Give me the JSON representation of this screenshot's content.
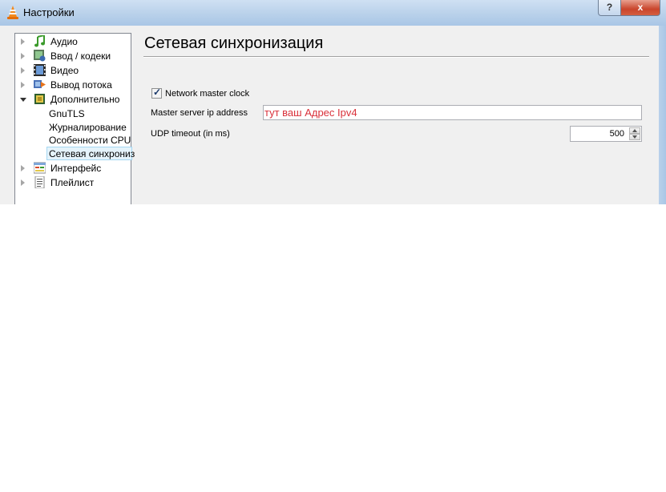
{
  "window": {
    "title": "Настройки",
    "help_label": "?",
    "close_label": "x"
  },
  "sidebar": {
    "items": [
      {
        "label": "Аудио",
        "icon": "music-note-icon",
        "expanded": false
      },
      {
        "label": "Ввод / кодеки",
        "icon": "input-codecs-icon",
        "expanded": false
      },
      {
        "label": "Видео",
        "icon": "film-icon",
        "expanded": false
      },
      {
        "label": "Вывод потока",
        "icon": "stream-output-icon",
        "expanded": false
      },
      {
        "label": "Дополнительно",
        "icon": "chip-icon",
        "expanded": true,
        "children": [
          {
            "label": "GnuTLS"
          },
          {
            "label": "Журналирование"
          },
          {
            "label": "Особенности CPU"
          },
          {
            "label": "Сетевая синхрониз",
            "selected": true
          }
        ]
      },
      {
        "label": "Интерфейс",
        "icon": "interface-icon",
        "expanded": false
      },
      {
        "label": "Плейлист",
        "icon": "playlist-icon",
        "expanded": false
      }
    ]
  },
  "panel": {
    "title": "Сетевая синхронизация",
    "network_master_clock": {
      "label": "Network master clock",
      "checked": true
    },
    "master_server_ip": {
      "label": "Master server ip address",
      "value": "тут ваш Адрес Ipv4"
    },
    "udp_timeout": {
      "label": "UDP timeout (in ms)",
      "value": "500"
    }
  },
  "colors": {
    "annotation_text": "#d9303a",
    "selection_bg": "#e5f3fb",
    "selection_border": "#a5d7f2"
  }
}
